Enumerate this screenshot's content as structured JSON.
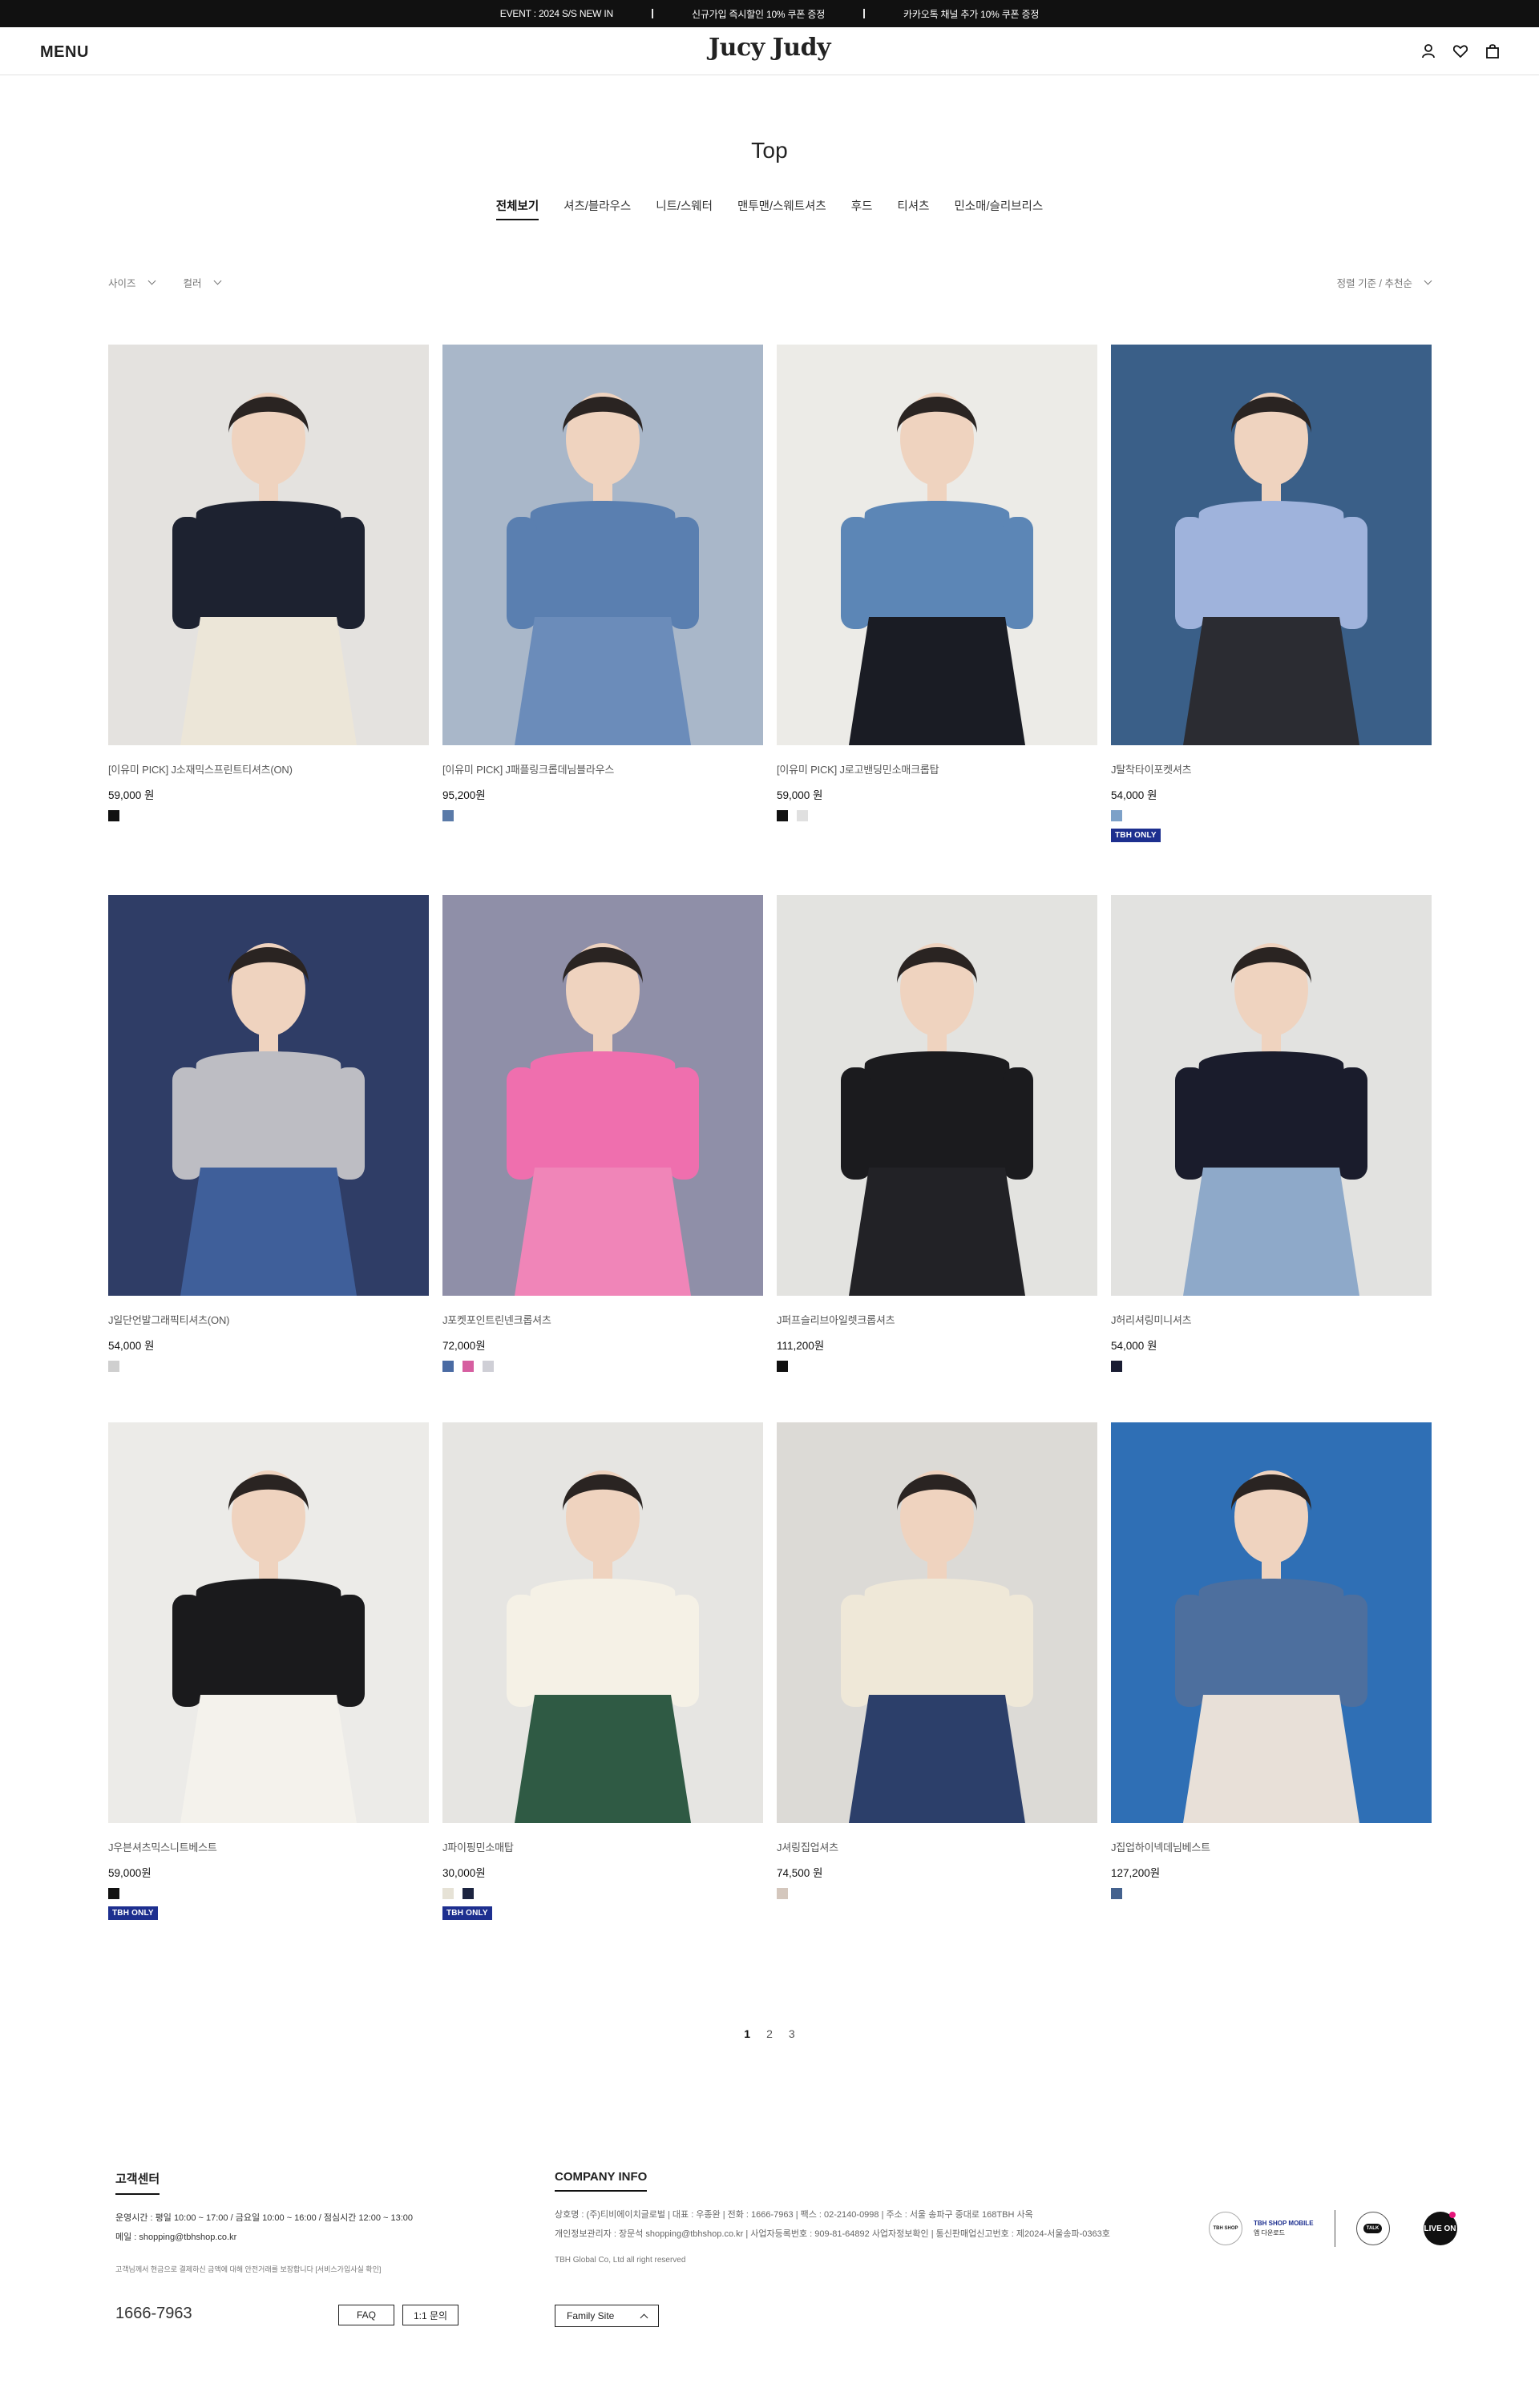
{
  "event_bar": {
    "items": [
      "EVENT : 2024 S/S NEW IN",
      "신규가입 즉시할인 10% 쿠폰 증정",
      "카카오톡 채널 추가 10% 쿠폰 증정"
    ]
  },
  "header": {
    "menu_label": "MENU",
    "logo": "Jucy Judy",
    "icons": [
      "user-icon",
      "heart-icon",
      "bag-icon"
    ]
  },
  "category": {
    "title": "Top",
    "tabs": [
      "전체보기",
      "셔츠/블라우스",
      "니트/스웨터",
      "맨투맨/스웨트셔츠",
      "후드",
      "티셔츠",
      "민소매/슬리브리스"
    ],
    "active_tab": 0
  },
  "filters": {
    "size_label": "사이즈",
    "color_label": "컬러",
    "sort_label": "정렬 기준 / 추천순"
  },
  "products": [
    {
      "name": "[이유미 PICK] J소재믹스프린트티셔츠(ON)",
      "price": "59,000 원",
      "swatches": [
        "#111111"
      ],
      "badge": "",
      "bg": "#e4e2df",
      "shirt": "#1d2230",
      "top2": "#ece6d8"
    },
    {
      "name": "[이유미 PICK] J패플링크롭데님블라우스",
      "price": "95,200원",
      "swatches": [
        "#5a7aa8"
      ],
      "badge": "",
      "bg": "#a9b7c9",
      "shirt": "#5a7fb0",
      "top2": "#6b8cba"
    },
    {
      "name": "[이유미 PICK] J로고밴딩민소매크롭탑",
      "price": "59,000 원",
      "swatches": [
        "#111111",
        "#e0e0e0"
      ],
      "badge": "",
      "bg": "#ecebe7",
      "shirt": "#5c86b6",
      "top2": "#1a1c24"
    },
    {
      "name": "J탈착타이포켓셔츠",
      "price": "54,000 원",
      "swatches": [
        "#7da1c8"
      ],
      "badge": "TBH ONLY",
      "bg": "#3a5f88",
      "shirt": "#9fb3dc",
      "top2": "#2b2c32"
    },
    {
      "name": "J일단언발그래픽티셔츠(ON)",
      "price": "54,000 원",
      "swatches": [
        "#cfcfcf"
      ],
      "badge": "",
      "bg": "#2f3d66",
      "shirt": "#bdbdc3",
      "top2": "#3f5f9a"
    },
    {
      "name": "J포켓포인트린넨크롭셔츠",
      "price": "72,000원",
      "swatches": [
        "#4a6ba3",
        "#d65ea0",
        "#cfcfd6"
      ],
      "badge": "",
      "bg": "#8f8fa8",
      "shirt": "#ef6fae",
      "top2": "#f085b8"
    },
    {
      "name": "J퍼프슬리브아일렛크롭셔츠",
      "price": "111,200원",
      "swatches": [
        "#111111"
      ],
      "badge": "",
      "bg": "#e3e3e0",
      "shirt": "#1b1b1e",
      "top2": "#222226"
    },
    {
      "name": "J허리셔링미니셔츠",
      "price": "54,000 원",
      "swatches": [
        "#1a1d33"
      ],
      "badge": "",
      "bg": "#e2e2e0",
      "shirt": "#1a1c2c",
      "top2": "#8ea9c9"
    },
    {
      "name": "J우븐셔츠믹스니트베스트",
      "price": "59,000원",
      "swatches": [
        "#111111"
      ],
      "badge": "TBH ONLY",
      "bg": "#ecebe8",
      "shirt": "#1a1a1c",
      "top2": "#f4f2ec"
    },
    {
      "name": "J파이핑민소매탑",
      "price": "30,000원",
      "swatches": [
        "#e6e2d6",
        "#1c2440"
      ],
      "badge": "TBH ONLY",
      "bg": "#e6e5e2",
      "shirt": "#f5f1e6",
      "top2": "#2f5a44"
    },
    {
      "name": "J셔링집업셔츠",
      "price": "74,500 원",
      "swatches": [
        "#d4c7bd"
      ],
      "badge": "",
      "bg": "#dcdad6",
      "shirt": "#efe8d8",
      "top2": "#2c3f6a"
    },
    {
      "name": "J집업하이넥데님베스트",
      "price": "127,200원",
      "swatches": [
        "#44628e"
      ],
      "badge": "",
      "bg": "#2f6fb5",
      "shirt": "#4d6f9e",
      "top2": "#e8e0d8"
    }
  ],
  "pagination": {
    "pages": [
      "1",
      "2",
      "3"
    ],
    "active": "1"
  },
  "footer": {
    "cs_title": "고객센터",
    "cs_hours": "운영시간 : 평일 10:00 ~ 17:00 / 금요일 10:00 ~ 16:00 / 점심시간 12:00 ~ 13:00",
    "cs_mail": "메일 : shopping@tbhshop.co.kr",
    "cs_notice": "고객님께서 현금으로 결제하신 금액에 대해 안전거래를 보장합니다 [서비스가입사실 확인]",
    "phone": "1666-7963",
    "faq_label": "FAQ",
    "qna_label": "1:1 문의",
    "ci_title": "COMPANY INFO",
    "ci_line1": "상호명 : (주)티비에이치글로벌  |  대표 : 우종완  |  전화 : 1666-7963  |  팩스 : 02-2140-0998  |  주소 : 서울 송파구 중대로 168TBH 사옥",
    "ci_line2": "개인정보관리자 : 장문석 shopping@tbhshop.co.kr  |  사업자등록번호 : 909-81-64892  사업자정보확인  |  통신판매업신고번호 : 제2024-서울송파-0363호",
    "copyright": "TBH Global Co, Ltd all right reserved",
    "family_label": "Family Site",
    "tbh_shop": "TBH SHOP",
    "tbh_mobile": "TBH SHOP MOBILE",
    "tbh_mobile_sub": "앱 다운로드",
    "talk": "TALK",
    "live": "LIVE ON"
  }
}
